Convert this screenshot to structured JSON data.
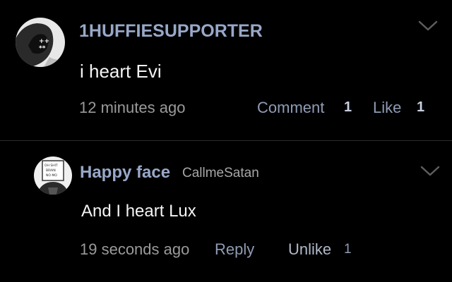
{
  "colors": {
    "background": "#000000",
    "username": "#98a8c8",
    "action": "#8f9cb4",
    "muted": "#9a9a9a",
    "count_dim": "#b9c3d6",
    "divider": "#2b2b2b"
  },
  "comments": [
    {
      "username": "1HUFFIESUPPORTER",
      "text": "i heart Evi",
      "timestamp": "12 minutes ago",
      "comment_label": "Comment",
      "comment_count": "1",
      "like_label": "Like",
      "like_count": "1",
      "avatar_icon": "user-avatar",
      "menu_icon": "chevron-down-icon"
    },
    {
      "username": "Happy face",
      "subname": "CallmeSatan",
      "text": "And I heart Lux",
      "timestamp": "19 seconds ago",
      "reply_label": "Reply",
      "unlike_label": "Unlike",
      "like_count": "1",
      "avatar_icon": "user-avatar",
      "menu_icon": "chevron-down-icon"
    }
  ]
}
